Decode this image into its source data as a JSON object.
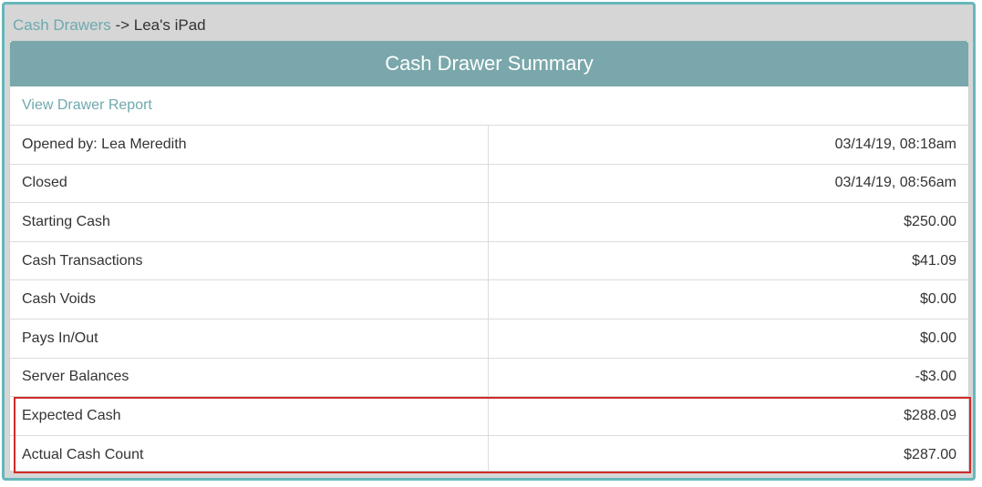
{
  "breadcrumb": {
    "link_label": "Cash Drawers",
    "separator": "->",
    "current": "Lea's iPad"
  },
  "panel": {
    "title": "Cash Drawer Summary",
    "report_link": "View Drawer Report"
  },
  "rows": [
    {
      "label": "Opened by: Lea Meredith",
      "value": "03/14/19, 08:18am"
    },
    {
      "label": "Closed",
      "value": "03/14/19, 08:56am"
    },
    {
      "label": "Starting Cash",
      "value": "$250.00"
    },
    {
      "label": "Cash Transactions",
      "value": "$41.09"
    },
    {
      "label": "Cash Voids",
      "value": "$0.00"
    },
    {
      "label": "Pays In/Out",
      "value": "$0.00"
    },
    {
      "label": "Server Balances",
      "value": "-$3.00"
    },
    {
      "label": "Expected Cash",
      "value": "$288.09"
    },
    {
      "label": "Actual Cash Count",
      "value": "$287.00"
    }
  ],
  "colors": {
    "frame_border": "#66b7bb",
    "header_bg": "#7aa7ab",
    "link": "#6fa9ad",
    "highlight": "#d12a2a"
  }
}
